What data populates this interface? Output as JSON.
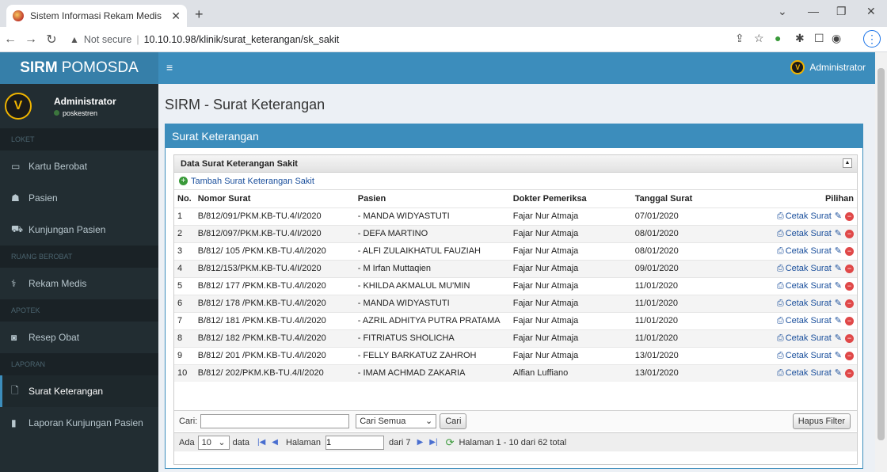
{
  "browser": {
    "tab_title": "Sistem Informasi Rekam Medis P",
    "not_secure": "Not secure",
    "url": "10.10.10.98/klinik/surat_keterangan/sk_sakit"
  },
  "app": {
    "logo_bold": "SIRM",
    "logo_rest": "POMOSDA",
    "user_name": "Administrator",
    "user_status": "poskestren",
    "top_user": "Administrator"
  },
  "sidebar": {
    "headers": [
      "LOKET",
      "RUANG BEROBAT",
      "APOTEK",
      "LAPORAN"
    ],
    "items": [
      {
        "label": "Kartu Berobat",
        "icon": "card-icon"
      },
      {
        "label": "Pasien",
        "icon": "users-icon"
      },
      {
        "label": "Kunjungan Pasien",
        "icon": "car-icon"
      },
      {
        "label": "Rekam Medis",
        "icon": "stethoscope-icon"
      },
      {
        "label": "Resep Obat",
        "icon": "pill-icon"
      },
      {
        "label": "Surat Keterangan",
        "icon": "file-icon"
      },
      {
        "label": "Laporan Kunjungan Pasien",
        "icon": "file-icon"
      }
    ]
  },
  "page": {
    "title": "SIRM - Surat Keterangan",
    "box_title": "Surat Keterangan",
    "grid_title": "Data Surat Keterangan Sakit",
    "add_label": "Tambah Surat Keterangan Sakit"
  },
  "table": {
    "headers": [
      "No.",
      "Nomor Surat",
      "Pasien",
      "Dokter Pemeriksa",
      "Tanggal Surat",
      "Pilihan"
    ],
    "action_label": "Cetak Surat",
    "rows": [
      [
        "1",
        "B/812/091/PKM.KB-TU.4/I/2020",
        "- MANDA WIDYASTUTI",
        "Fajar Nur Atmaja",
        "07/01/2020"
      ],
      [
        "2",
        "B/812/097/PKM.KB-TU.4/I/2020",
        "- DEFA MARTINO",
        "Fajar Nur Atmaja",
        "08/01/2020"
      ],
      [
        "3",
        "B/812/ 105 /PKM.KB-TU.4/I/2020",
        "- ALFI ZULAIKHATUL FAUZIAH",
        "Fajar Nur Atmaja",
        "08/01/2020"
      ],
      [
        "4",
        "B/812/153/PKM.KB-TU.4/I/2020",
        "- M Irfan Muttaqien",
        "Fajar Nur Atmaja",
        "09/01/2020"
      ],
      [
        "5",
        "B/812/ 177 /PKM.KB-TU.4/I/2020",
        "- KHILDA AKMALUL MU'MIN",
        "Fajar Nur Atmaja",
        "11/01/2020"
      ],
      [
        "6",
        "B/812/ 178 /PKM.KB-TU.4/I/2020",
        "- MANDA WIDYASTUTI",
        "Fajar Nur Atmaja",
        "11/01/2020"
      ],
      [
        "7",
        "B/812/ 181 /PKM.KB-TU.4/I/2020",
        "- AZRIL ADHITYA PUTRA PRATAMA",
        "Fajar Nur Atmaja",
        "11/01/2020"
      ],
      [
        "8",
        "B/812/ 182 /PKM.KB-TU.4/I/2020",
        "- FITRIATUS SHOLICHA",
        "Fajar Nur Atmaja",
        "11/01/2020"
      ],
      [
        "9",
        "B/812/ 201 /PKM.KB-TU.4/I/2020",
        "- FELLY BARKATUZ ZAHROH",
        "Fajar Nur Atmaja",
        "13/01/2020"
      ],
      [
        "10",
        "B/812/ 202/PKM.KB-TU.4/I/2020",
        "- IMAM ACHMAD ZAKARIA",
        "Alfian Luffiano",
        "13/01/2020"
      ]
    ]
  },
  "filter": {
    "label": "Cari:",
    "select_value": "Cari Semua",
    "search_button": "Cari",
    "reset_button": "Hapus Filter"
  },
  "pager": {
    "ada": "Ada",
    "per_page": "10",
    "data": "data",
    "halaman": "Halaman",
    "page_value": "1",
    "dari": "dari 7",
    "summary": "Halaman 1 - 10 dari 62 total"
  }
}
